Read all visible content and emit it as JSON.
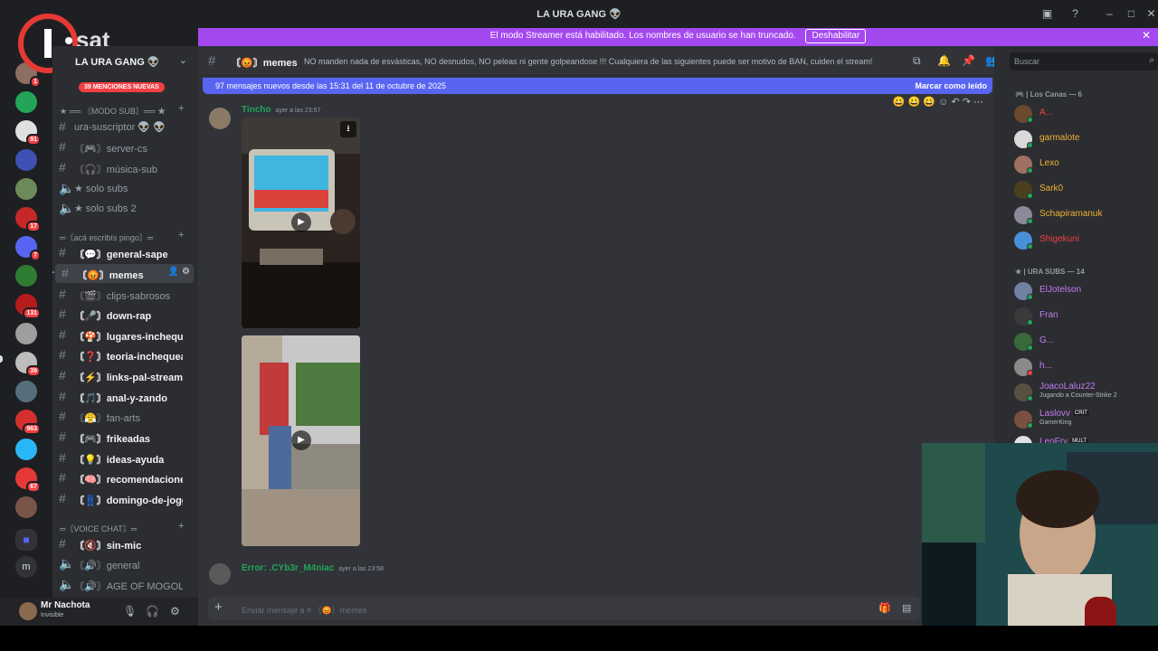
{
  "window": {
    "title": "LA URA GANG 👽"
  },
  "stream_banner": {
    "text": "El modo Streamer está habilitado. Los nombres de usuario se han truncado.",
    "button": "Deshabilitar",
    "close": "✕"
  },
  "logo": {
    "text": "I.sat"
  },
  "servers": {
    "badges": [
      "1",
      "91",
      "17",
      "7",
      "131",
      "39",
      "963",
      "67"
    ],
    "bottom_label": "m"
  },
  "server": {
    "name": "LA URA GANG 👽",
    "mentions": "39 MENCIONES NUEVAS"
  },
  "categories": {
    "modo_sub": "★ ══ 〘MODO SUB〙══ ★",
    "aca": "═〘acá escribís pingo〙═",
    "voice": "═〘VOICE CHAT〙═"
  },
  "channels": [
    {
      "name": "ura-suscriptor 👽 👽",
      "type": "text",
      "bold": false
    },
    {
      "name": "〘🎮〙server-cs",
      "type": "text",
      "bold": false
    },
    {
      "name": "〘🎧〙música-sub",
      "type": "text",
      "bold": false
    },
    {
      "name": "★ solo subs",
      "type": "voice",
      "bold": false
    },
    {
      "name": "★ solo subs 2",
      "type": "voice",
      "bold": false
    },
    {
      "name": "〘💬〙general-sape",
      "type": "text",
      "bold": true
    },
    {
      "name": "〘😡〙memes",
      "type": "text",
      "bold": true,
      "selected": true
    },
    {
      "name": "〘🎬〙clips-sabrosos",
      "type": "text",
      "bold": false
    },
    {
      "name": "〘🎤〙down-rap",
      "type": "text",
      "bold": true
    },
    {
      "name": "〘🍄〙lugares-inchequ...",
      "type": "text",
      "bold": true
    },
    {
      "name": "〘❓〙teoria-inchequea...",
      "type": "text",
      "bold": true
    },
    {
      "name": "〘⚡〙links-pal-stream",
      "type": "text",
      "bold": true
    },
    {
      "name": "〘🎵〙anal-y-zando",
      "type": "text",
      "bold": true
    },
    {
      "name": "〘😤〙fan-arts",
      "type": "text",
      "bold": false
    },
    {
      "name": "〘🎮〙frikeadas",
      "type": "text",
      "bold": true
    },
    {
      "name": "〘💡〙ideas-ayuda",
      "type": "text",
      "bold": true
    },
    {
      "name": "〘🧠〙recomendaciones",
      "type": "text",
      "bold": true
    },
    {
      "name": "〘👖〙domingo-de-joggin",
      "type": "text",
      "bold": true
    },
    {
      "name": "〘🔇〙sin-mic",
      "type": "text",
      "bold": true
    },
    {
      "name": "〘🔊〙general",
      "type": "voice",
      "bold": false
    },
    {
      "name": "〘🔊〙AGE OF MOGOL...",
      "type": "voice",
      "bold": false
    }
  ],
  "user": {
    "name": "Mr Nachota",
    "status": "Invisible"
  },
  "channel_header": {
    "name": "〘😡〙memes",
    "topic": "NO manden nada de esvásticas, NO desnudos, NO peleas ni gente golpeandose !!! Cualquiera de las siguientes puede ser motivo de BAN, cuiden el stream!"
  },
  "new_messages": {
    "text": "97 mensajes nuevos desde las 15:31 del 11 de octubre de 2025",
    "mark_read": "Marcar como leído"
  },
  "messages": [
    {
      "author": "Tincho",
      "time": "ayer a las 23:57"
    },
    {
      "author": "Error: .CYb3r_M4niac",
      "time": "ayer a las 23:58"
    }
  ],
  "composer": {
    "placeholder": "Enviar mensaje a # 〘😡〙memes"
  },
  "search": {
    "placeholder": "Buscar"
  },
  "member_groups": [
    {
      "title": "🎮 | Los Canas — 6",
      "members": [
        {
          "name": "A...",
          "color": "#f23f43"
        },
        {
          "name": "garmalote",
          "color": "#f0b232"
        },
        {
          "name": "Lexo",
          "color": "#f0b232"
        },
        {
          "name": "Sark0",
          "color": "#f0b232"
        },
        {
          "name": "Schapiramanuk",
          "color": "#f0b232"
        },
        {
          "name": "Shigekuni",
          "color": "#f23f43"
        }
      ]
    },
    {
      "title": "★ | URA SUBS — 14",
      "members": [
        {
          "name": "ElJotelson",
          "color": "#c27cee"
        },
        {
          "name": "Fran",
          "color": "#c27cee"
        },
        {
          "name": "G...",
          "color": "#c27cee"
        },
        {
          "name": "h...",
          "color": "#c27cee"
        },
        {
          "name": "JoacoLaluz22",
          "color": "#c27cee",
          "activity": "Jugando a Counter-Strike 2"
        },
        {
          "name": "Laslovv",
          "color": "#c27cee",
          "tag": "CRIT",
          "activity": "GamerKing"
        },
        {
          "name": "LeoFry",
          "color": "#c27cee",
          "tag": "MULT"
        }
      ]
    }
  ]
}
